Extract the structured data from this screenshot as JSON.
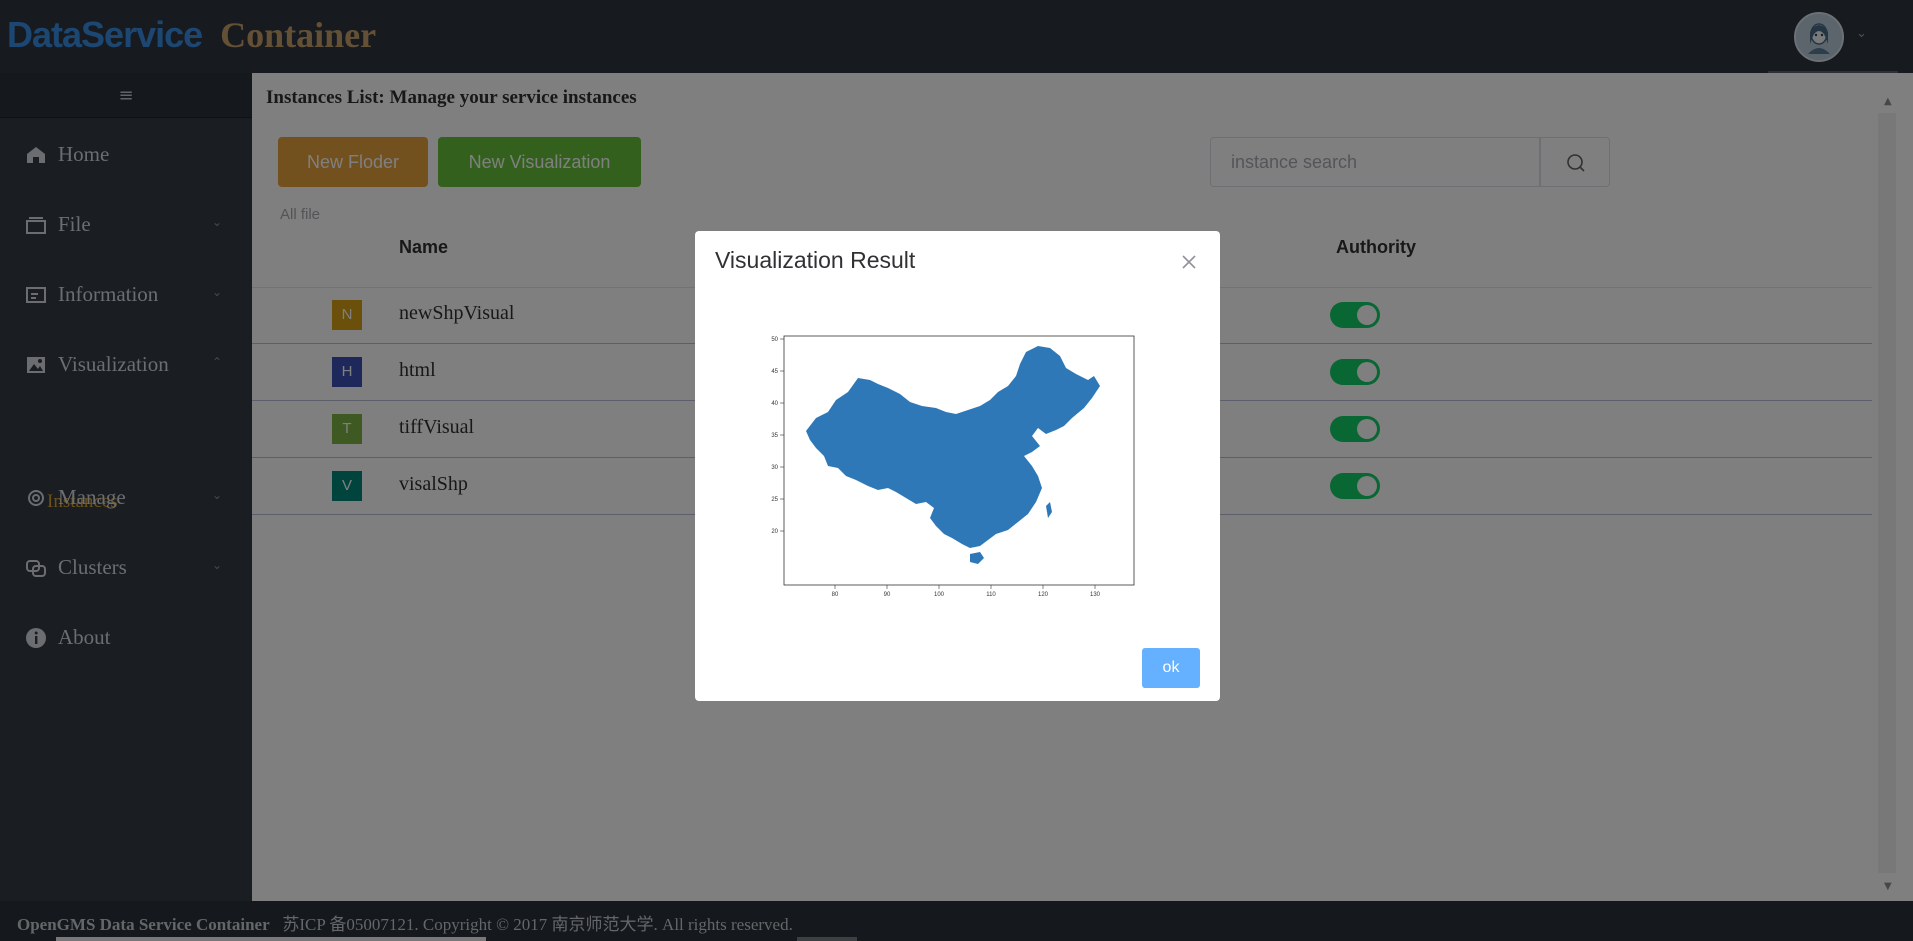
{
  "header": {
    "logo_part1": "DataService",
    "logo_part2": "Container",
    "avatar_icon": "user-avatar-icon",
    "dropdown_icon": "chevron-down-icon"
  },
  "sidebar": {
    "toggle_icon": "hamburger-icon",
    "toggle_glyph": "≡",
    "items": [
      {
        "label": "Home",
        "icon": "home-icon"
      },
      {
        "label": "File",
        "icon": "file-icon"
      },
      {
        "label": "Information",
        "icon": "information-icon"
      },
      {
        "label": "Visualization",
        "icon": "image-icon"
      },
      {
        "label": "Manage",
        "icon": "gear-icon"
      },
      {
        "label": "Clusters",
        "icon": "clusters-icon"
      },
      {
        "label": "About",
        "icon": "info-circle-icon"
      }
    ],
    "sub_item": "Instances",
    "chevron_down": "⌄",
    "chevron_up": "⌃"
  },
  "main": {
    "title": "Instances List: Manage your service instances",
    "new_folder_label": "New Floder",
    "new_visualization_label": "New Visualization",
    "search_placeholder": "instance search",
    "breadcrumb": "All file",
    "columns": {
      "name": "Name",
      "authority": "Authority"
    },
    "rows": [
      {
        "badge": "N",
        "badge_color": "#d4a017",
        "name": "newShpVisual",
        "authority": true
      },
      {
        "badge": "H",
        "badge_color": "#3f51b5",
        "name": "html",
        "authority": true
      },
      {
        "badge": "T",
        "badge_color": "#7cb342",
        "name": "tiffVisual",
        "authority": true
      },
      {
        "badge": "V",
        "badge_color": "#00897b",
        "name": "visalShp",
        "authority": true
      }
    ]
  },
  "footer": {
    "brand": "OpenGMS Data Service Container",
    "text": "苏ICP 备05007121. Copyright © 2017 南京师范大学. All rights reserved."
  },
  "modal": {
    "title": "Visualization Result",
    "ok_label": "ok",
    "map": {
      "fill": "#2e78b8",
      "x_ticks": [
        "80",
        "90",
        "100",
        "110",
        "120",
        "130"
      ],
      "y_ticks": [
        "50",
        "45",
        "40",
        "35",
        "30",
        "25",
        "20"
      ]
    }
  },
  "colors": {
    "header_bg": "#2f3640",
    "sidebar_bg": "#343b45",
    "accent_yellow": "#d7a32d",
    "btn_warning": "#e6a23c",
    "btn_success": "#67c23a",
    "switch_on": "#13ce66",
    "ok_button": "#66b1ff"
  }
}
